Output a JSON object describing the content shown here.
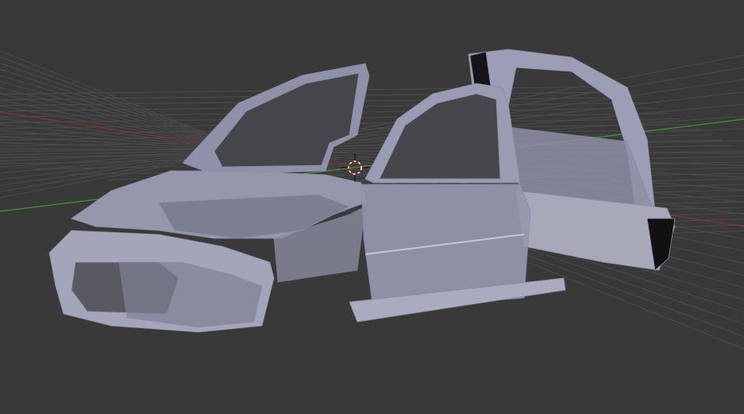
{
  "viewport": {
    "background_color": "#393939",
    "grid_color": "#4a4a4a",
    "x_axis_color": "#9a2a2a",
    "y_axis_color": "#3f8a2f",
    "mesh_color": "#9ea0b8",
    "mesh_shadow_color": "#6e7085",
    "cursor_icon": "3d-cursor-icon"
  }
}
